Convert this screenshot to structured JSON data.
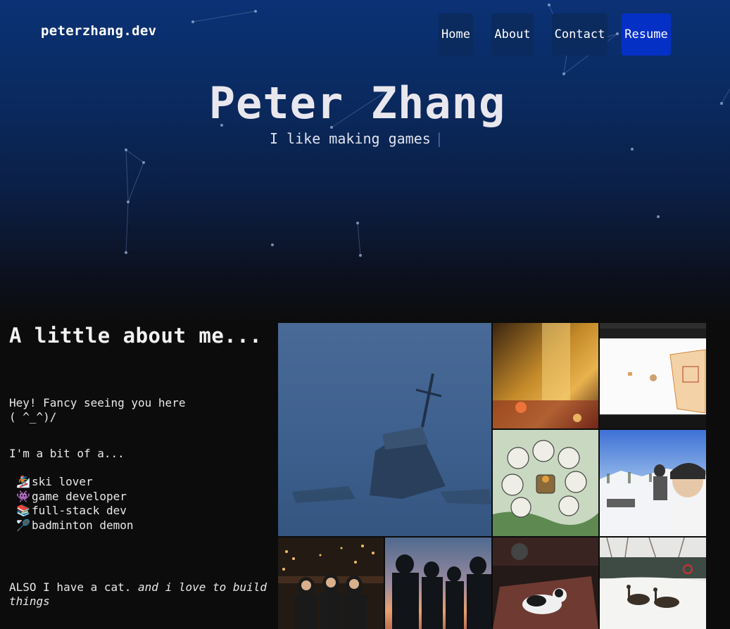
{
  "site": {
    "logo": "peterzhang.dev"
  },
  "nav": {
    "items": [
      {
        "label": "Home",
        "active": false
      },
      {
        "label": "About",
        "active": false
      },
      {
        "label": "Contact",
        "active": false
      },
      {
        "label": "Resume",
        "active": true
      }
    ]
  },
  "hero": {
    "title": "Peter Zhang",
    "subtitle": "I like making games",
    "caret": "|"
  },
  "about": {
    "heading": "A little about me...",
    "greeting": "Hey! Fancy seeing you here",
    "kaomoji": "( ^_^)/",
    "intro": "I'm a bit of a...",
    "traits": [
      {
        "icon": "🏂",
        "icon_name": "snowboarder-icon",
        "label": "ski lover"
      },
      {
        "icon": "👾",
        "icon_name": "alien-monster-icon",
        "label": "game developer"
      },
      {
        "icon": "📚",
        "icon_name": "books-icon",
        "label": "full-stack dev"
      },
      {
        "icon": "🏸",
        "icon_name": "badminton-icon",
        "label": "badminton demon"
      }
    ],
    "cat_prefix": "ALSO I have a cat.",
    "cat_emphasis": "and i love to build things"
  },
  "gallery": {
    "tiles": [
      {
        "name": "shipwreck-painting",
        "subject": "sunken ship in a blue snowstorm"
      },
      {
        "name": "city-lights-photo",
        "subject": "blurred night city lights"
      },
      {
        "name": "dev-screenshot",
        "subject": "code editor with a 3D scene"
      },
      {
        "name": "bunny-game-art",
        "subject": "game art of bunnies around a campfire"
      },
      {
        "name": "ski-selfie-photo",
        "subject": "skiers on a snowy mountain"
      },
      {
        "name": "night-market-photo",
        "subject": "friends at a night market"
      },
      {
        "name": "sunset-silhouettes-photo",
        "subject": "friends silhouetted at sunset"
      },
      {
        "name": "cat-photo",
        "subject": "cat lying on a red rug"
      },
      {
        "name": "geese-photo",
        "subject": "geese by a snowy pond"
      }
    ]
  },
  "colors": {
    "accent": "#0530c6",
    "nav_bg": "#0b2a5e",
    "kaomoji": "#2a8de8",
    "page_bg": "#0c0c0c"
  }
}
